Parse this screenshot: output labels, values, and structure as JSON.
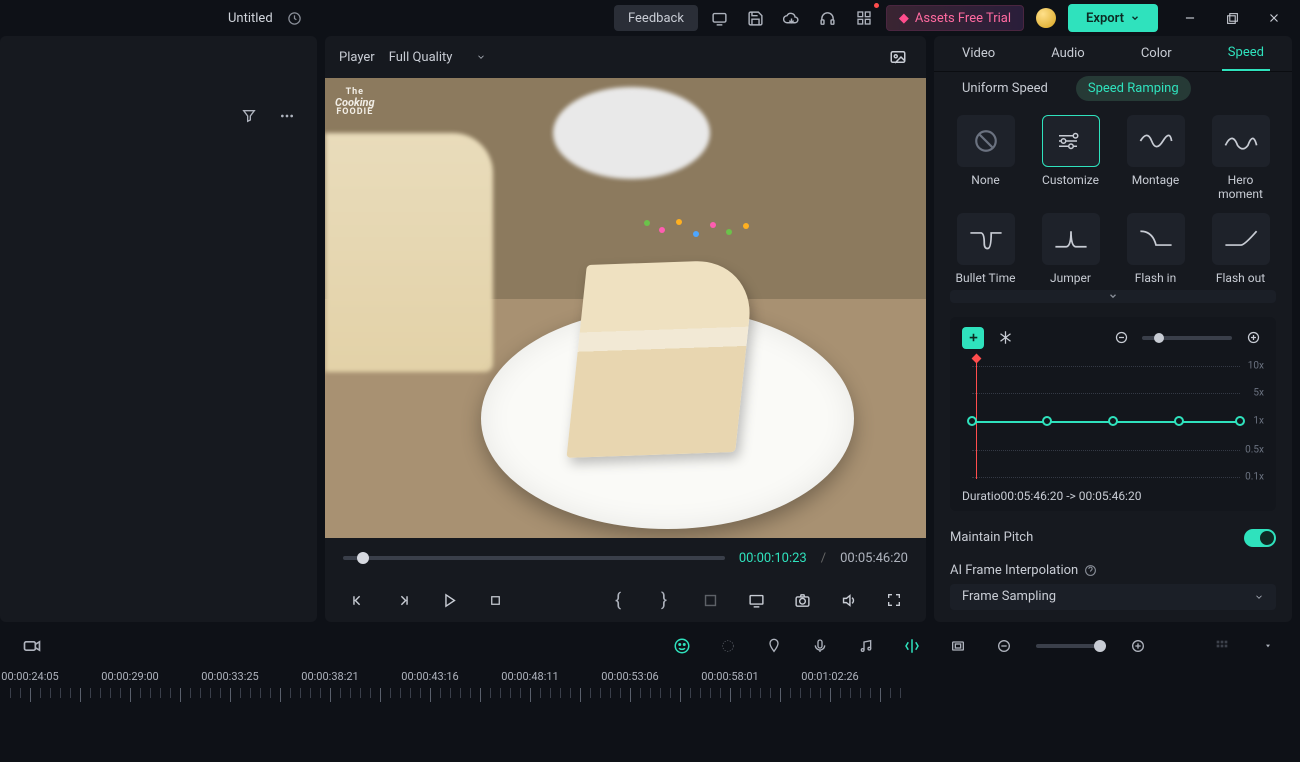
{
  "header": {
    "title": "Untitled",
    "feedback": "Feedback",
    "assets_trial": "Assets Free Trial",
    "export": "Export"
  },
  "player": {
    "label": "Player",
    "quality": "Full Quality",
    "current_time": "00:00:10:23",
    "total_time": "00:05:46:20",
    "separator": "/"
  },
  "tabs": {
    "items": [
      "Video",
      "Audio",
      "Color",
      "Speed"
    ],
    "active": "Speed",
    "sub": {
      "uniform": "Uniform Speed",
      "ramping": "Speed Ramping"
    }
  },
  "presets": [
    {
      "label": "None"
    },
    {
      "label": "Customize",
      "selected": true
    },
    {
      "label": "Montage"
    },
    {
      "label": "Hero moment"
    },
    {
      "label": "Bullet Time"
    },
    {
      "label": "Jumper"
    },
    {
      "label": "Flash in"
    },
    {
      "label": "Flash out"
    }
  ],
  "graph": {
    "ylabels": [
      "10x",
      "5x",
      "1x",
      "0.5x",
      "0.1x"
    ],
    "duration_label": "Duratio",
    "duration_from": "00:05:46:20",
    "duration_arrow": "->",
    "duration_to": "00:05:46:20"
  },
  "maintain_pitch": "Maintain Pitch",
  "ai_interp": {
    "label": "AI Frame Interpolation",
    "value": "Frame Sampling"
  },
  "timeline": {
    "stamps": [
      "00:00:24:05",
      "00:00:29:00",
      "00:00:33:25",
      "00:00:38:21",
      "00:00:43:16",
      "00:00:48:11",
      "00:00:53:06",
      "00:00:58:01",
      "00:01:02:26"
    ]
  },
  "preview_logo": {
    "top": "The",
    "mid": "Cooking",
    "bot": "FOODIE"
  }
}
